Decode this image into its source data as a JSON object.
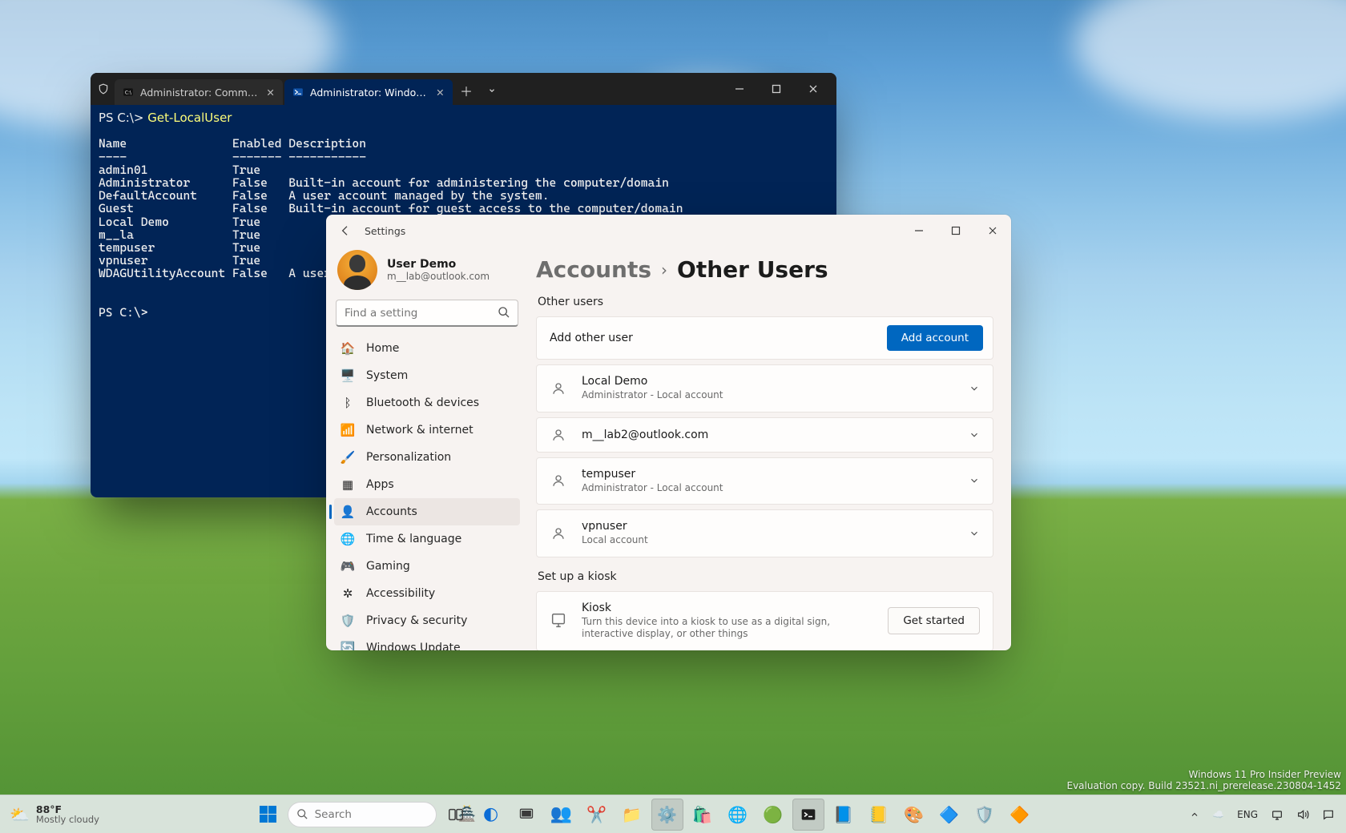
{
  "terminal": {
    "tabs": [
      {
        "label": "Administrator: Command Prom",
        "active": false
      },
      {
        "label": "Administrator: Windows Powe",
        "active": true
      }
    ],
    "prompt1": "PS C:\\> ",
    "command": "Get-LocalUser",
    "header_name": "Name",
    "header_enabled": "Enabled",
    "header_desc": "Description",
    "rule_name": "----",
    "rule_enabled": "-------",
    "rule_desc": "-----------",
    "rows": [
      {
        "name": "admin01",
        "enabled": "True",
        "desc": ""
      },
      {
        "name": "Administrator",
        "enabled": "False",
        "desc": "Built-in account for administering the computer/domain"
      },
      {
        "name": "DefaultAccount",
        "enabled": "False",
        "desc": "A user account managed by the system."
      },
      {
        "name": "Guest",
        "enabled": "False",
        "desc": "Built-in account for guest access to the computer/domain"
      },
      {
        "name": "Local Demo",
        "enabled": "True",
        "desc": ""
      },
      {
        "name": "m__la",
        "enabled": "True",
        "desc": ""
      },
      {
        "name": "tempuser",
        "enabled": "True",
        "desc": ""
      },
      {
        "name": "vpnuser",
        "enabled": "True",
        "desc": ""
      },
      {
        "name": "WDAGUtilityAccount",
        "enabled": "False",
        "desc": "A user acco"
      }
    ],
    "prompt2": "PS C:\\>"
  },
  "settings": {
    "title": "Settings",
    "profile_name": "User Demo",
    "profile_email": "m__lab@outlook.com",
    "search_placeholder": "Find a setting",
    "nav": [
      {
        "icon": "🏠",
        "label": "Home"
      },
      {
        "icon": "🖥️",
        "label": "System"
      },
      {
        "icon": "ᛒ",
        "label": "Bluetooth & devices"
      },
      {
        "icon": "📶",
        "label": "Network & internet"
      },
      {
        "icon": "🖌️",
        "label": "Personalization"
      },
      {
        "icon": "▦",
        "label": "Apps"
      },
      {
        "icon": "👤",
        "label": "Accounts"
      },
      {
        "icon": "🌐",
        "label": "Time & language"
      },
      {
        "icon": "🎮",
        "label": "Gaming"
      },
      {
        "icon": "✲",
        "label": "Accessibility"
      },
      {
        "icon": "🛡️",
        "label": "Privacy & security"
      },
      {
        "icon": "🔄",
        "label": "Windows Update"
      }
    ],
    "nav_active_index": 6,
    "crumb_parent": "Accounts",
    "crumb_sep": "›",
    "crumb_current": "Other Users",
    "section_other_users": "Other users",
    "add_other_user": "Add other user",
    "add_account_btn": "Add account",
    "users": [
      {
        "name": "Local Demo",
        "sub": "Administrator - Local account"
      },
      {
        "name": "m__lab2@outlook.com",
        "sub": ""
      },
      {
        "name": "tempuser",
        "sub": "Administrator - Local account"
      },
      {
        "name": "vpnuser",
        "sub": "Local account"
      }
    ],
    "section_kiosk": "Set up a kiosk",
    "kiosk_title": "Kiosk",
    "kiosk_sub": "Turn this device into a kiosk to use as a digital sign, interactive display, or other things",
    "kiosk_btn": "Get started"
  },
  "taskbar": {
    "weather_temp": "88°F",
    "weather_desc": "Mostly cloudy",
    "search_placeholder": "Search",
    "lang": "ENG",
    "watermark1": "Windows 11 Pro Insider Preview",
    "watermark2": "Evaluation copy. Build 23521.ni_prerelease.230804-1452"
  }
}
